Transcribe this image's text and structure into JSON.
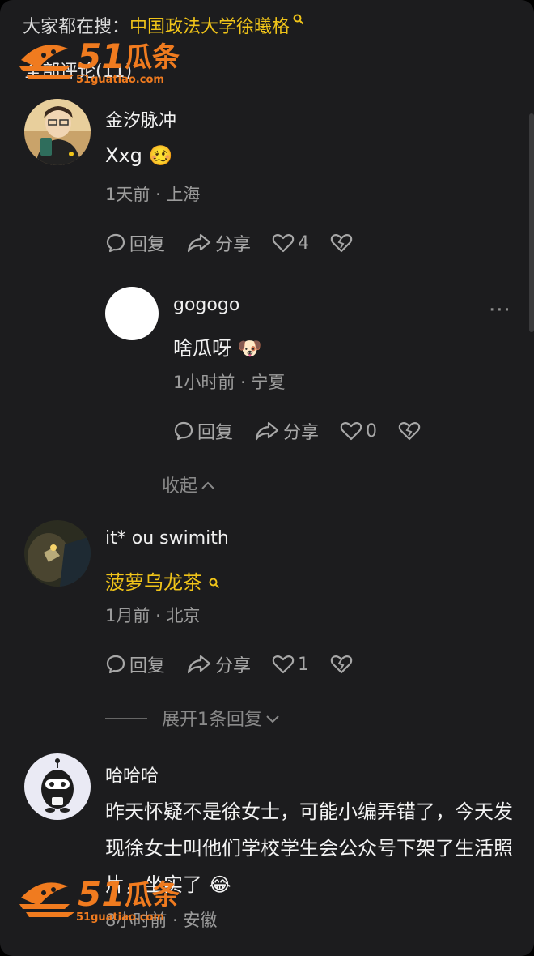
{
  "search": {
    "prefix": "大家都在搜：",
    "term": "中国政法大学徐曦格"
  },
  "section": {
    "title": "全部评论(11)"
  },
  "watermark": {
    "brand": "51瓜条",
    "url": "51guatiao.com"
  },
  "comments": [
    {
      "username": "金汐脉冲",
      "content": "Xxg",
      "emoji": "🥴",
      "time": "1天前",
      "location": "上海",
      "reply_label": "回复",
      "share_label": "分享",
      "likes": "4"
    },
    {
      "username": "gogogo",
      "content": "啥瓜呀",
      "emoji": "🐶",
      "time": "1小时前",
      "location": "宁夏",
      "reply_label": "回复",
      "share_label": "分享",
      "likes": "0",
      "more": "···"
    },
    {
      "username": "it* ou swimith",
      "content": "菠萝乌龙茶",
      "time": "1月前",
      "location": "北京",
      "reply_label": "回复",
      "share_label": "分享",
      "likes": "1"
    },
    {
      "username": "哈哈哈",
      "content": "昨天怀疑不是徐女士，可能小编弄错了，今天发现徐女士叫他们学校学生会公众号下架了生活照片，坐实了",
      "emoji": "😂",
      "time": "8小时前",
      "location": "安徽"
    }
  ],
  "collapse_label": "收起",
  "expand_label": "展开1条回复",
  "separator": "·",
  "colors": {
    "accent": "#f0c419",
    "background": "#1c1c1e"
  }
}
